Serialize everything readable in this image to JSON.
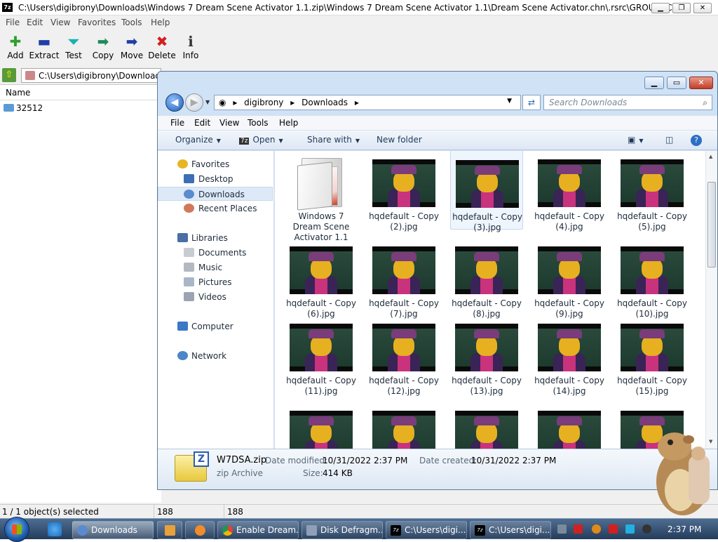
{
  "sevenzip": {
    "title": "C:\\Users\\digibrony\\Downloads\\Windows 7 Dream Scene Activator 1.1.zip\\Windows 7 Dream Scene Activator 1.1\\Dream Scene Activator.chn\\.rsrc\\GROUP_ICON\\",
    "logo_text": "7z",
    "menu": [
      "File",
      "Edit",
      "View",
      "Favorites",
      "Tools",
      "Help"
    ],
    "toolbar": [
      {
        "label": "Add",
        "icon": "plus-icon",
        "glyph": "✚",
        "color": "#2da02d"
      },
      {
        "label": "Extract",
        "icon": "minus-icon",
        "glyph": "▬",
        "color": "#1f3fa8"
      },
      {
        "label": "Test",
        "icon": "check-down-icon",
        "glyph": "⏷",
        "color": "#19b3b3"
      },
      {
        "label": "Copy",
        "icon": "arrow-right-icon",
        "glyph": "➡",
        "color": "#1d8a5a"
      },
      {
        "label": "Move",
        "icon": "arrow-right-icon",
        "glyph": "➡",
        "color": "#1f3fa8"
      },
      {
        "label": "Delete",
        "icon": "x-icon",
        "glyph": "✖",
        "color": "#d21f1f"
      },
      {
        "label": "Info",
        "icon": "info-icon",
        "glyph": "ℹ",
        "color": "#333333"
      }
    ],
    "address": "C:\\Users\\digibrony\\Downloads\\",
    "column_name": "Name",
    "items": [
      "32512"
    ],
    "status": {
      "selected": "1 / 1 object(s) selected",
      "size1": "188",
      "size2": "188"
    }
  },
  "explorer": {
    "breadcrumb": [
      "digibrony",
      "Downloads"
    ],
    "search_placeholder": "Search Downloads",
    "menu": [
      "File",
      "Edit",
      "View",
      "Tools",
      "Help"
    ],
    "commands": {
      "organize": "Organize",
      "open": "Open",
      "share": "Share with",
      "new_folder": "New folder"
    },
    "nav": {
      "favorites": "Favorites",
      "desktop": "Desktop",
      "downloads": "Downloads",
      "recent": "Recent Places",
      "libraries": "Libraries",
      "documents": "Documents",
      "music": "Music",
      "pictures": "Pictures",
      "videos": "Videos",
      "computer": "Computer",
      "network": "Network"
    },
    "files": [
      {
        "name": "Windows 7 Dream Scene Activator 1.1",
        "kind": "folder"
      },
      {
        "name": "hqdefault - Copy (2).jpg",
        "kind": "image"
      },
      {
        "name": "hqdefault - Copy (3).jpg",
        "kind": "image",
        "selected": true
      },
      {
        "name": "hqdefault - Copy (4).jpg",
        "kind": "image"
      },
      {
        "name": "hqdefault - Copy (5).jpg",
        "kind": "image"
      },
      {
        "name": "hqdefault - Copy (6).jpg",
        "kind": "image"
      },
      {
        "name": "hqdefault - Copy (7).jpg",
        "kind": "image"
      },
      {
        "name": "hqdefault - Copy (8).jpg",
        "kind": "image"
      },
      {
        "name": "hqdefault - Copy (9).jpg",
        "kind": "image"
      },
      {
        "name": "hqdefault - Copy (10).jpg",
        "kind": "image"
      },
      {
        "name": "hqdefault - Copy (11).jpg",
        "kind": "image"
      },
      {
        "name": "hqdefault - Copy (12).jpg",
        "kind": "image"
      },
      {
        "name": "hqdefault - Copy (13).jpg",
        "kind": "image"
      },
      {
        "name": "hqdefault - Copy (14).jpg",
        "kind": "image"
      },
      {
        "name": "hqdefault - Copy (15).jpg",
        "kind": "image"
      },
      {
        "name": "",
        "kind": "image"
      },
      {
        "name": "",
        "kind": "image"
      },
      {
        "name": "",
        "kind": "image"
      },
      {
        "name": "",
        "kind": "image"
      },
      {
        "name": "",
        "kind": "image"
      }
    ],
    "details": {
      "filename": "W7DSA.zip",
      "type": "zip Archive",
      "modified_label": "Date modified:",
      "modified": "10/31/2022 2:37 PM",
      "created_label": "Date created:",
      "created": "10/31/2022 2:37 PM",
      "size_label": "Size:",
      "size": "414 KB"
    }
  },
  "taskbar": {
    "items": [
      "Downloads",
      "",
      "",
      "Enable Dream...",
      "Disk Defragm...",
      "C:\\Users\\digi...",
      "C:\\Users\\digi..."
    ],
    "clock": "2:37 PM"
  }
}
